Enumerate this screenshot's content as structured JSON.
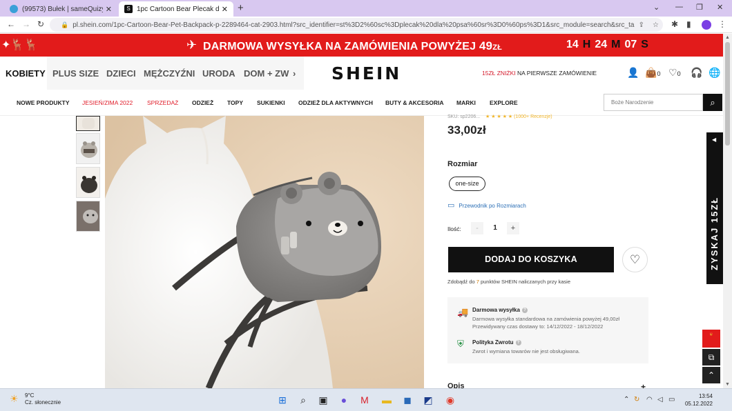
{
  "browser": {
    "tabs": [
      {
        "title": "(99573) Bułek | sameQuizy",
        "active": false
      },
      {
        "title": "1pc Cartoon Bear Plecak dla zwierząt",
        "active": true
      }
    ],
    "new_tab": "+",
    "url": "pl.shein.com/1pc-Cartoon-Bear-Pet-Backpack-p-2289464-cat-2903.html?src_identifier=st%3D2%60sc%3Dplecak%20dla%20psa%60sr%3D0%60ps%3D1&src_module=search&src_tab_page_i..."
  },
  "promo": {
    "message_prefix": "DARMOWA WYSYŁKA NA ZAMÓWIENIA POWYŻEJ ",
    "message_amount": "49",
    "message_suffix": "ZŁ",
    "timer": {
      "h": "14",
      "h_unit": "H",
      "m": "24",
      "m_unit": "M",
      "s": "07",
      "s_unit": "S"
    }
  },
  "header": {
    "categories": [
      "KOBIETY",
      "PLUS SIZE",
      "DZIECI",
      "MĘŻCZYŹNI",
      "URODA",
      "DOM + ZW"
    ],
    "logo": "SHEIN",
    "discount_red": "15ZŁ ZNIŻKI",
    "discount_rest": " NA PIERWSZE ZAMÓWIENIE",
    "cart_count": "0",
    "wish_count": "0"
  },
  "subnav": {
    "items": [
      "NOWE PRODUKTY",
      "JESIEŃ/ZIMA 2022",
      "SPRZEDAŻ",
      "ODZIEŻ",
      "TOPY",
      "SUKIENKI",
      "ODZIEŻ DLA AKTYWNYCH",
      "BUTY & AKCESORIA",
      "MARKI",
      "EXPLORE"
    ],
    "search_placeholder": "Boże Narodzenie"
  },
  "product": {
    "rating_text": "SKU: sp2206...",
    "stars": "★ ★ ★ ★ ★",
    "reviews": "(1000+ Recenzje)",
    "price": "33,00zł",
    "size_label": "Rozmiar",
    "size_option": "one-size",
    "size_guide": "Przewodnik po Rozmiarach",
    "qty_label": "Ilość:",
    "qty_minus": "-",
    "qty_value": "1",
    "qty_plus": "+",
    "add_to_cart": "DODAJ DO KOSZYKA",
    "points_prefix": "Zdobądź do ",
    "points_num": "7",
    "points_suffix": " punktów SHEIN naliczanych przy kasie",
    "shipping_title": "Darmowa wysyłka",
    "shipping_line1": "Darmowa wysyłka standardowa na zamówienia powyżej 49,00zł",
    "shipping_line2": "Przewidywany czas dostawy to: 14/12/2022 - 18/12/2022",
    "return_title": "Polityka Zwrotu",
    "return_line": "Zwrot i wymiana towarów nie jest obsługiwana.",
    "opis": "Opis",
    "opis_plus": "+"
  },
  "side": {
    "coupon": "ZYSKAJ 15ZŁ"
  },
  "taskbar": {
    "temp": "9°C",
    "weather": "Cz. słonecznie",
    "time": "13:54",
    "date": "05.12.2022"
  },
  "colors": {
    "promo_red": "#e21b1b",
    "accent_red": "#d4192a",
    "link_blue": "#2a6eb5",
    "tab_strip": "#d8c8f0"
  }
}
